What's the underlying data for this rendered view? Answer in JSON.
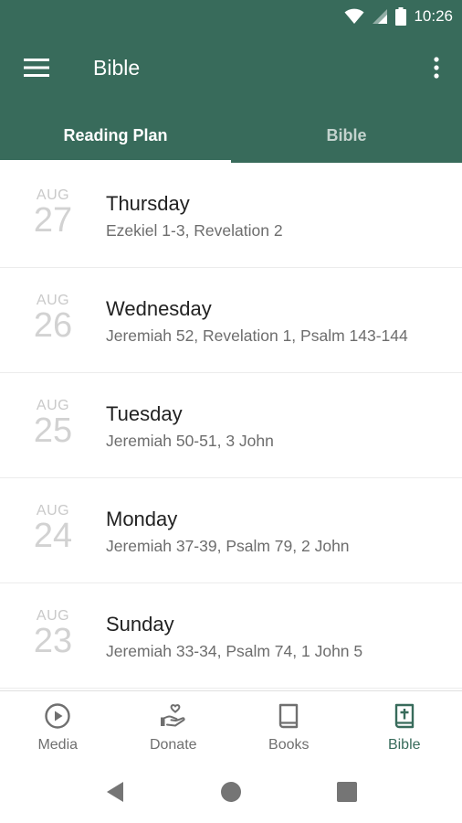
{
  "status_bar": {
    "time": "10:26"
  },
  "app_bar": {
    "title": "Bible"
  },
  "tabs": [
    {
      "label": "Reading Plan",
      "active": true
    },
    {
      "label": "Bible",
      "active": false
    }
  ],
  "readings": [
    {
      "month": "AUG",
      "day": "27",
      "weekday": "Thursday",
      "passages": "Ezekiel 1-3, Revelation 2"
    },
    {
      "month": "AUG",
      "day": "26",
      "weekday": "Wednesday",
      "passages": "Jeremiah 52, Revelation 1, Psalm 143-144"
    },
    {
      "month": "AUG",
      "day": "25",
      "weekday": "Tuesday",
      "passages": "Jeremiah 50-51, 3 John"
    },
    {
      "month": "AUG",
      "day": "24",
      "weekday": "Monday",
      "passages": "Jeremiah 37-39, Psalm 79, 2 John"
    },
    {
      "month": "AUG",
      "day": "23",
      "weekday": "Sunday",
      "passages": "Jeremiah 33-34, Psalm 74, 1 John 5"
    }
  ],
  "bottom_nav": [
    {
      "label": "Media",
      "icon": "play-circle-icon",
      "active": false
    },
    {
      "label": "Donate",
      "icon": "donate-hand-heart-icon",
      "active": false
    },
    {
      "label": "Books",
      "icon": "book-icon",
      "active": false
    },
    {
      "label": "Bible",
      "icon": "bible-cross-icon",
      "active": true
    }
  ],
  "colors": {
    "primary": "#386b5b",
    "active_nav": "#386b5b",
    "inactive_nav": "#6f6f6f"
  }
}
